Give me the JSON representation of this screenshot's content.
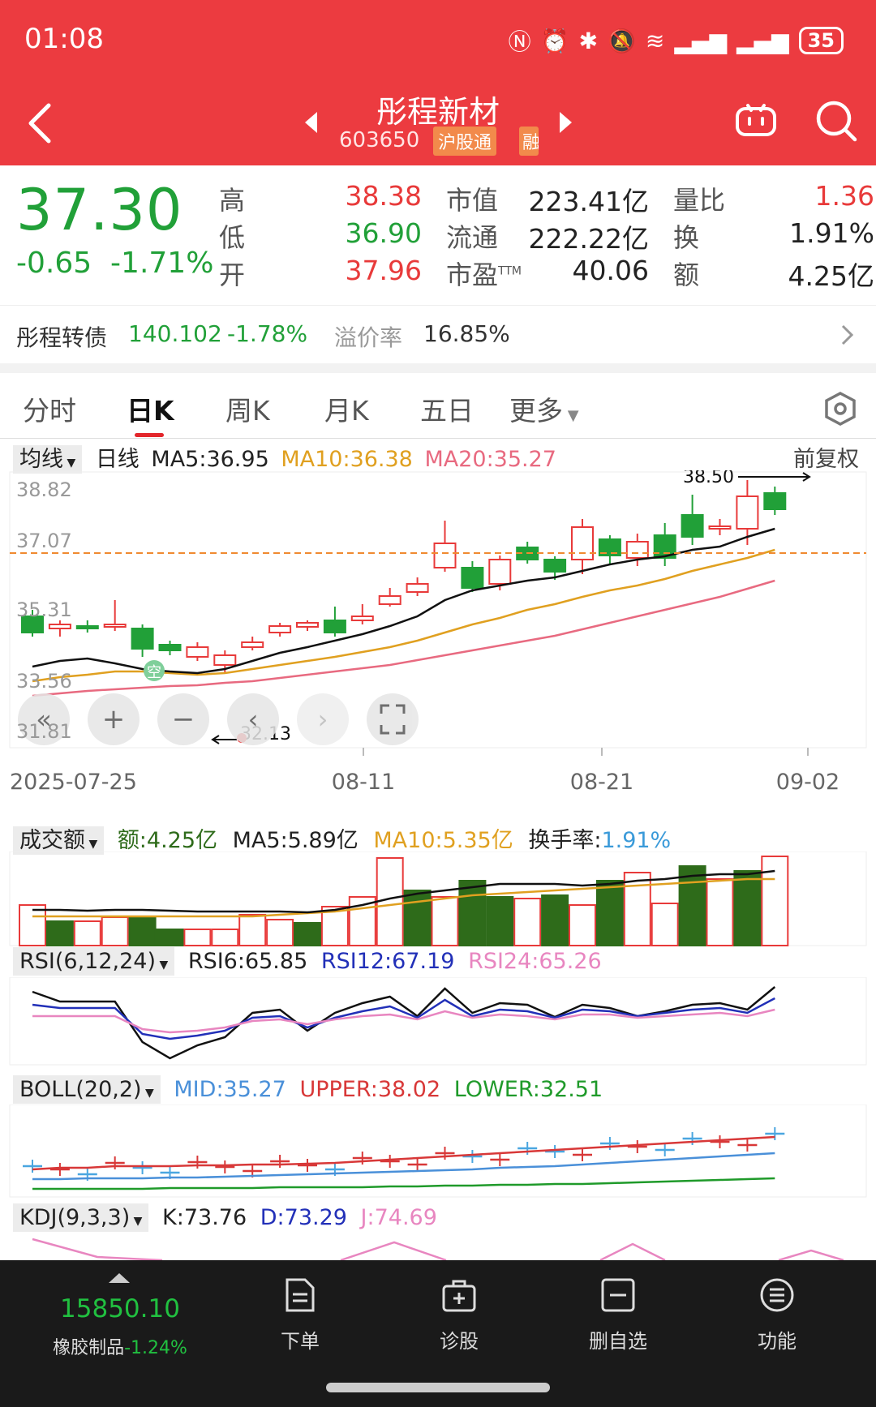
{
  "status": {
    "time": "01:08",
    "battery": "35"
  },
  "header": {
    "stock_name": "彤程新材",
    "stock_code": "603650",
    "tag_hgt": "沪股通",
    "tag_rong": "融"
  },
  "quote": {
    "price": "37.30",
    "change": "-0.65",
    "change_pct": "-1.71%",
    "high_label": "高",
    "high": "38.38",
    "low_label": "低",
    "low": "36.90",
    "open_label": "开",
    "open": "37.96",
    "mcap_label": "市值",
    "mcap": "223.41亿",
    "float_label": "流通",
    "float": "222.22亿",
    "pe_label": "市盈",
    "pe_sup": "TTM",
    "pe": "40.06",
    "vr_label": "量比",
    "vr": "1.36",
    "turnover_label": "换",
    "turnover": "1.91%",
    "amount_label": "额",
    "amount": "4.25亿"
  },
  "bond": {
    "name": "彤程转债",
    "price": "140.102",
    "pct": "-1.78%",
    "premium_label": "溢价率",
    "premium": "16.85%"
  },
  "tabs": [
    "分时",
    "日K",
    "周K",
    "月K",
    "五日",
    "更多"
  ],
  "kline_legend": {
    "dropdown": "均线",
    "period": "日线",
    "ma5": "MA5:36.95",
    "ma10": "MA10:36.38",
    "ma20": "MA20:35.27",
    "adjust": "前复权"
  },
  "kline": {
    "y_ticks": [
      "38.82",
      "37.07",
      "35.31",
      "33.56",
      "31.81"
    ],
    "x_ticks": [
      "2025-07-25",
      "08-11",
      "08-21",
      "09-02"
    ],
    "high_annotation": "38.50",
    "low_annotation": "32.13",
    "marker_label": "空"
  },
  "volume_legend": {
    "dropdown": "成交额",
    "amount": "额:4.25亿",
    "ma5": "MA5:5.89亿",
    "ma10": "MA10:5.35亿",
    "turnover_label": "换手率:",
    "turnover": "1.91%"
  },
  "rsi_legend": {
    "dropdown": "RSI(6,12,24)",
    "rsi6": "RSI6:65.85",
    "rsi12": "RSI12:67.19",
    "rsi24": "RSI24:65.26"
  },
  "boll_legend": {
    "dropdown": "BOLL(20,2)",
    "mid": "MID:35.27",
    "upper": "UPPER:38.02",
    "lower": "LOWER:32.51"
  },
  "kdj_legend": {
    "dropdown": "KDJ(9,3,3)",
    "k": "K:73.76",
    "d": "D:73.29",
    "j": "J:74.69"
  },
  "bottom_nav": {
    "index_value": "15850.10",
    "index_name": "橡胶制品",
    "index_pct": "-1.24%",
    "order": "下单",
    "diagnose": "诊股",
    "remove_fav": "删自选",
    "functions": "功能"
  },
  "colors": {
    "header_bg": "#ec3b40",
    "up": "#e83a3a",
    "down": "#21a038",
    "ma5": "#111111",
    "ma10": "#e0a020",
    "ma20": "#e86a80"
  }
}
